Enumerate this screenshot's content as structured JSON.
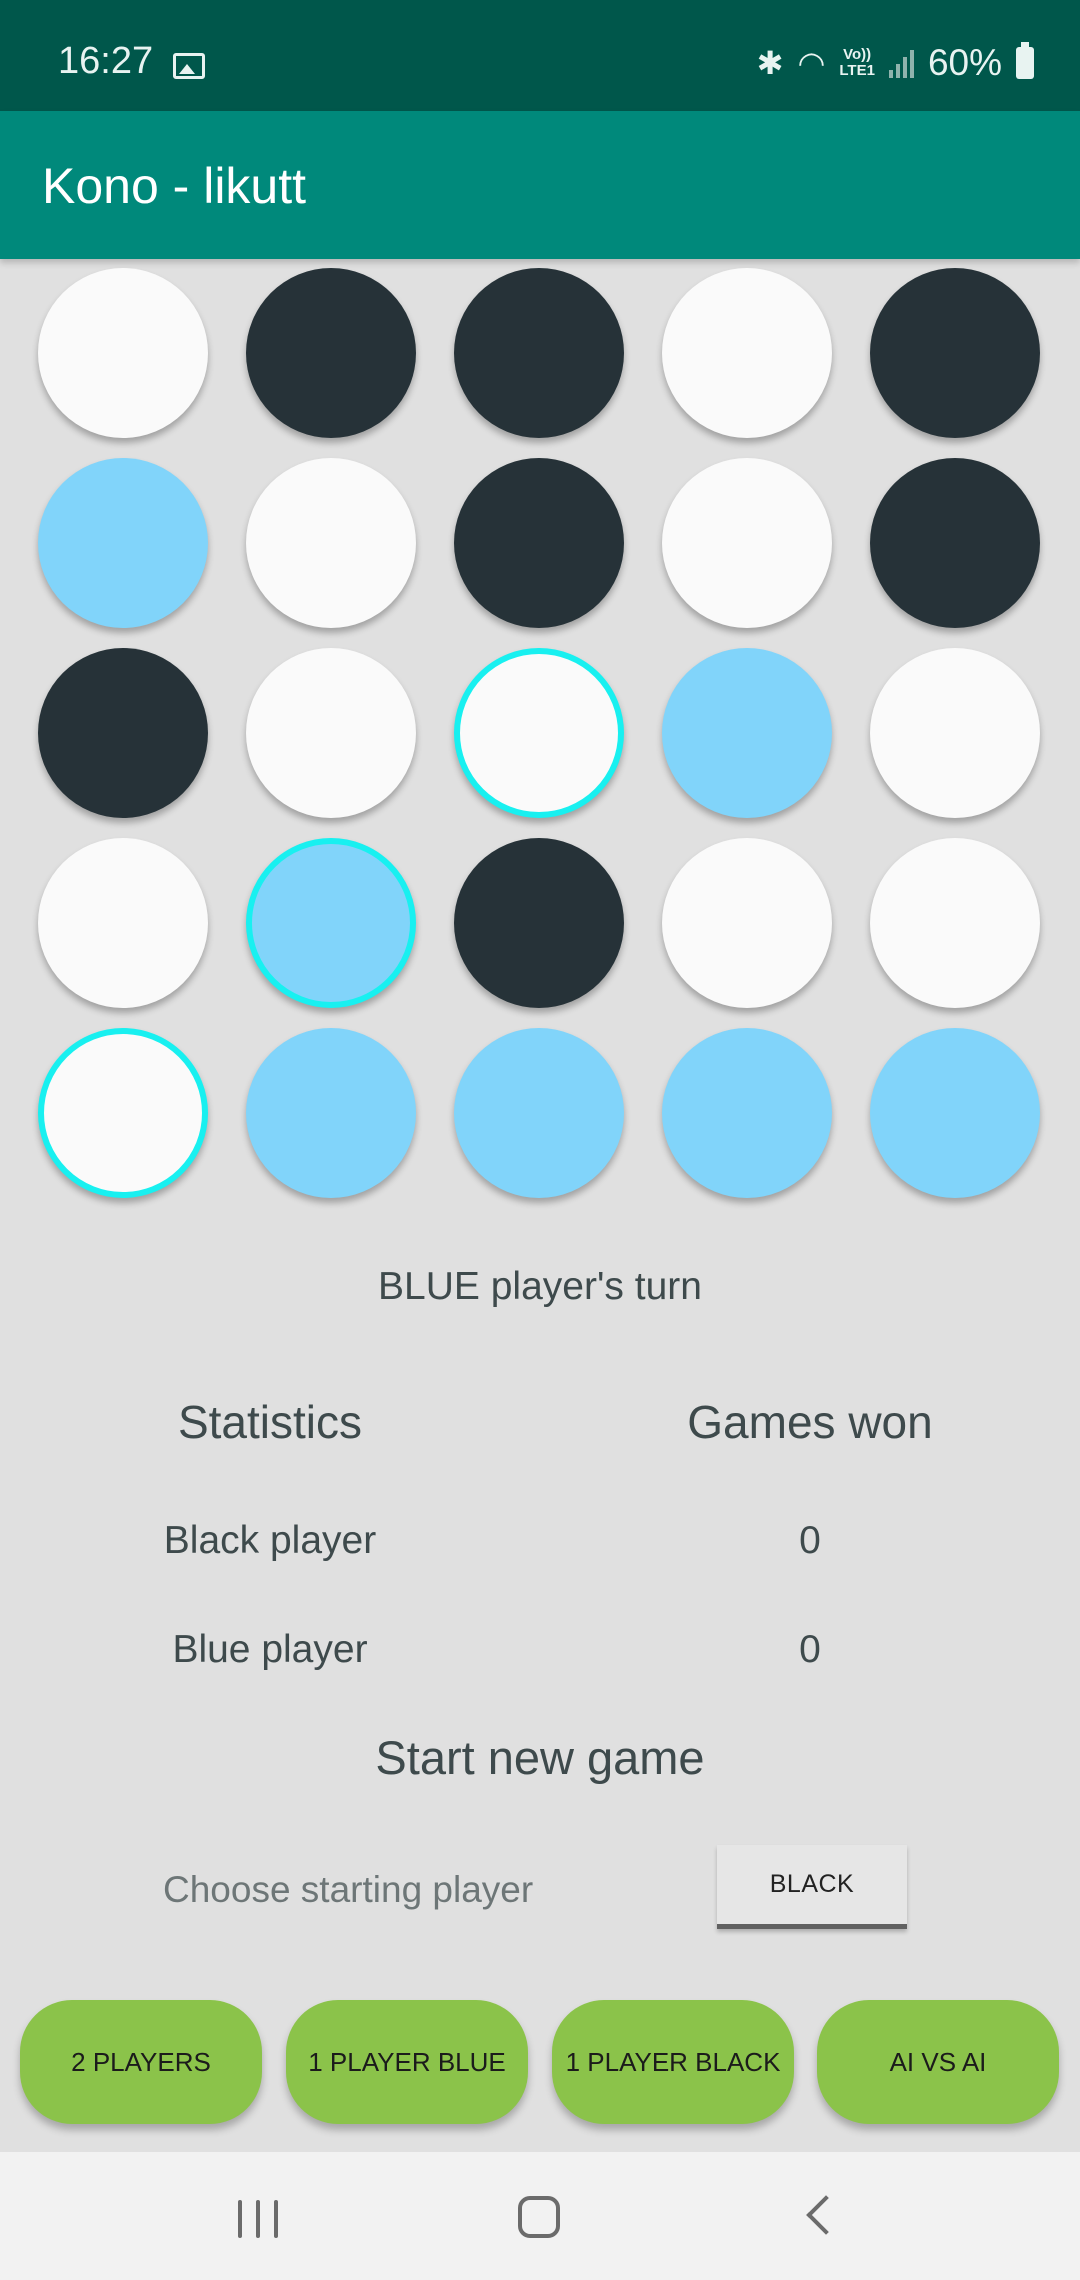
{
  "status_bar": {
    "time": "16:27",
    "battery": "60%",
    "lte_top": "Vo))",
    "lte_bottom": "LTE1",
    "icons": [
      "image-icon",
      "bluetooth-icon",
      "wifi-icon",
      "volte-icon",
      "signal-icon",
      "battery-icon"
    ]
  },
  "app_bar": {
    "title": "Kono - likutt"
  },
  "board": {
    "cells": [
      {
        "color": "white",
        "highlight": false
      },
      {
        "color": "black",
        "highlight": false
      },
      {
        "color": "black",
        "highlight": false
      },
      {
        "color": "white",
        "highlight": false
      },
      {
        "color": "black",
        "highlight": false
      },
      {
        "color": "blue",
        "highlight": false
      },
      {
        "color": "white",
        "highlight": false
      },
      {
        "color": "black",
        "highlight": false
      },
      {
        "color": "white",
        "highlight": false
      },
      {
        "color": "black",
        "highlight": false
      },
      {
        "color": "black",
        "highlight": false
      },
      {
        "color": "white",
        "highlight": false
      },
      {
        "color": "white",
        "highlight": true
      },
      {
        "color": "blue",
        "highlight": false
      },
      {
        "color": "white",
        "highlight": false
      },
      {
        "color": "white",
        "highlight": false
      },
      {
        "color": "blue",
        "highlight": true
      },
      {
        "color": "black",
        "highlight": false
      },
      {
        "color": "white",
        "highlight": false
      },
      {
        "color": "white",
        "highlight": false
      },
      {
        "color": "white",
        "highlight": true
      },
      {
        "color": "blue",
        "highlight": false
      },
      {
        "color": "blue",
        "highlight": false
      },
      {
        "color": "blue",
        "highlight": false
      },
      {
        "color": "blue",
        "highlight": false
      }
    ],
    "colors": {
      "white": "#fafafa",
      "black": "#263238",
      "blue": "#81d4fa",
      "highlight": "#18f0f0"
    }
  },
  "turn_text": "BLUE player's turn",
  "statistics": {
    "header_left": "Statistics",
    "header_right": "Games won",
    "rows": [
      {
        "label": "Black player",
        "value": "0"
      },
      {
        "label": "Blue player",
        "value": "0"
      }
    ]
  },
  "new_game": {
    "title": "Start new game",
    "choose_label": "Choose starting player",
    "starting_player": "BLACK"
  },
  "modes": [
    "2 PLAYERS",
    "1 PLAYER BLUE",
    "1 PLAYER BLACK",
    "AI VS AI"
  ],
  "theme": {
    "status_bar": "#00574b",
    "app_bar": "#00897b",
    "background": "#e0e0e0",
    "mode_button": "#8bc34a"
  }
}
